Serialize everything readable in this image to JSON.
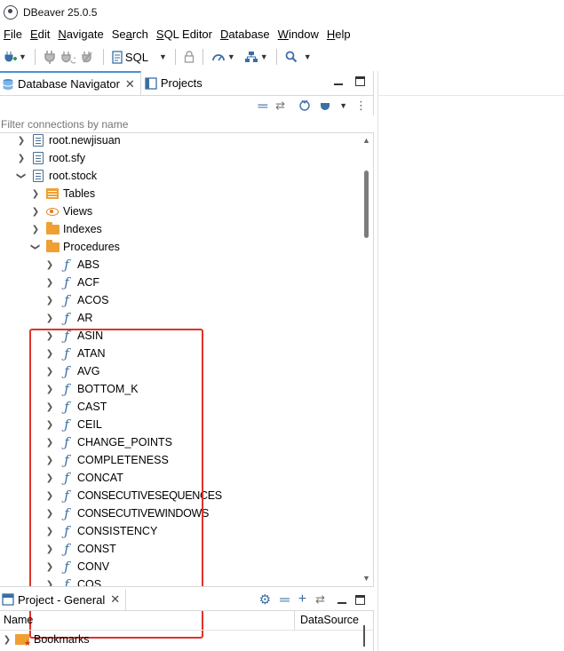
{
  "window": {
    "title": "DBeaver 25.0.5"
  },
  "menu": [
    {
      "pre": "",
      "u": "F",
      "post": "ile"
    },
    {
      "pre": "",
      "u": "E",
      "post": "dit"
    },
    {
      "pre": "",
      "u": "N",
      "post": "avigate"
    },
    {
      "pre": "Se",
      "u": "a",
      "post": "rch"
    },
    {
      "pre": "",
      "u": "S",
      "post": "QL Editor"
    },
    {
      "pre": "",
      "u": "D",
      "post": "atabase"
    },
    {
      "pre": "",
      "u": "W",
      "post": "indow"
    },
    {
      "pre": "",
      "u": "H",
      "post": "elp"
    }
  ],
  "toolbar": {
    "sql_label": "SQL"
  },
  "navigator": {
    "tab_label": "Database Navigator",
    "projects_tab_label": "Projects",
    "filter_placeholder": "Filter connections by name"
  },
  "tree": {
    "connections": [
      "root.newjisuan",
      "root.sfy",
      "root.stock"
    ],
    "folders": [
      "Tables",
      "Views",
      "Indexes",
      "Procedures"
    ],
    "procedures": [
      "ABS",
      "ACF",
      "ACOS",
      "AR",
      "ASIN",
      "ATAN",
      "AVG",
      "BOTTOM_K",
      "CAST",
      "CEIL",
      "CHANGE_POINTS",
      "COMPLETENESS",
      "CONCAT",
      "CONSECUTIVESEQUENCES",
      "CONSECUTIVEWINDOWS",
      "CONSISTENCY",
      "CONST",
      "CONV",
      "COS"
    ]
  },
  "project_panel": {
    "tab_label": "Project - General",
    "columns": {
      "name": "Name",
      "datasource": "DataSource"
    },
    "items": [
      "Bookmarks"
    ]
  },
  "colors": {
    "highlight_border": "#e0322c",
    "accent": "#4a90d9",
    "folder": "#f0a032"
  }
}
